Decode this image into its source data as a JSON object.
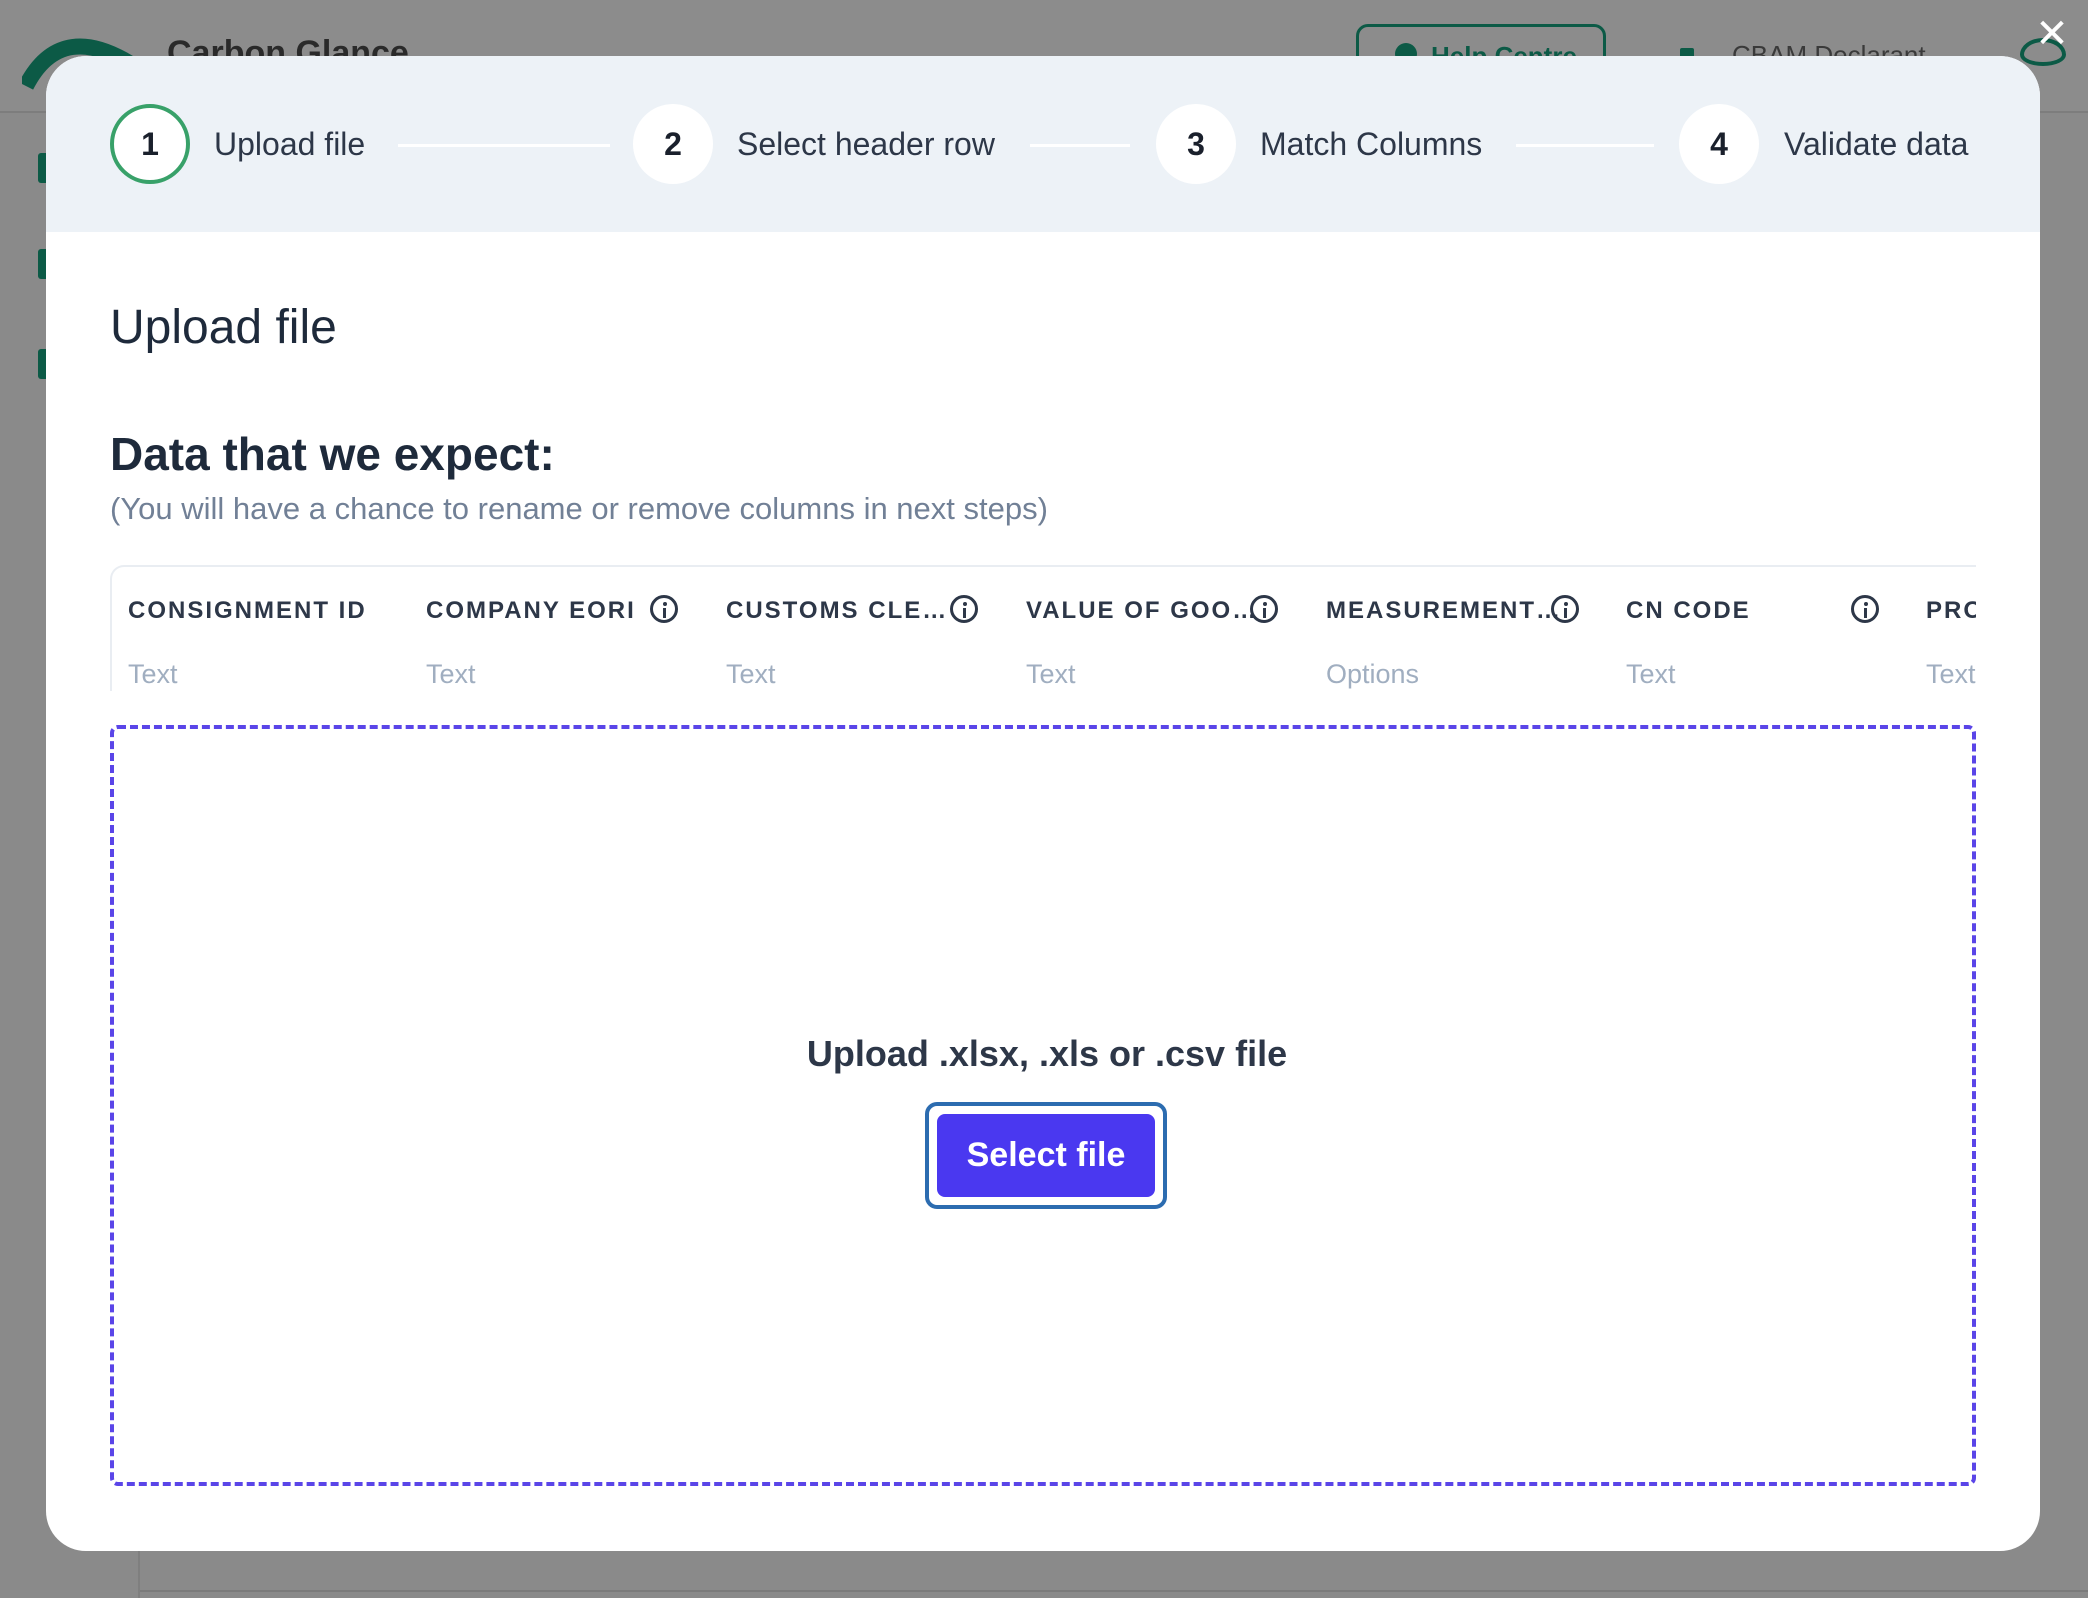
{
  "background": {
    "brand": "Carbon Glance",
    "help_label": "Help Centre",
    "user_label": "CBAM Declarant"
  },
  "dialog": {
    "close_label": "✕",
    "steps": [
      {
        "number": "1",
        "label": "Upload file",
        "active": true
      },
      {
        "number": "2",
        "label": "Select header row",
        "active": false
      },
      {
        "number": "3",
        "label": "Match Columns",
        "active": false
      },
      {
        "number": "4",
        "label": "Validate data",
        "active": false
      }
    ],
    "title": "Upload file",
    "expected_heading": "Data that we expect:",
    "expected_hint": "(You will have a chance to rename or remove columns in next steps)",
    "columns": [
      {
        "header": "CONSIGNMENT ID",
        "type": "Text",
        "has_info": false
      },
      {
        "header": "COMPANY EORI",
        "type": "Text",
        "has_info": true
      },
      {
        "header": "CUSTOMS CLE…",
        "type": "Text",
        "has_info": true
      },
      {
        "header": "VALUE OF GOO…",
        "type": "Text",
        "has_info": true
      },
      {
        "header": "MEASUREMENT…",
        "type": "Options",
        "has_info": true
      },
      {
        "header": "CN CODE",
        "type": "Text",
        "has_info": true
      },
      {
        "header": "PRO",
        "type": "Text",
        "has_info": false
      }
    ],
    "dropzone": {
      "text": "Upload .xlsx, .xls or .csv file",
      "button_label": "Select file"
    }
  },
  "colors": {
    "accent": "#4a38f0",
    "active_step": "#38a169",
    "dropzone_border": "#5a45e8",
    "brand_green": "#0c5a46"
  }
}
